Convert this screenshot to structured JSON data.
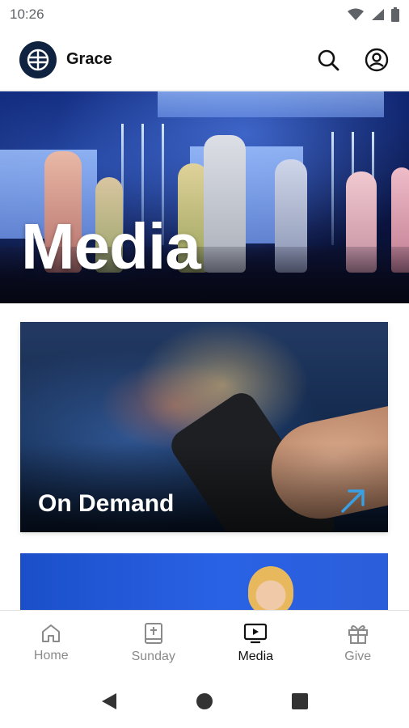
{
  "status_bar": {
    "time": "10:26"
  },
  "header": {
    "brand": "Grace"
  },
  "hero": {
    "title": "Media"
  },
  "cards": [
    {
      "title": "On Demand"
    }
  ],
  "bottom_nav": {
    "items": [
      {
        "label": "Home",
        "icon": "home-icon"
      },
      {
        "label": "Sunday",
        "icon": "bible-icon"
      },
      {
        "label": "Media",
        "icon": "tv-play-icon",
        "active": true
      },
      {
        "label": "Give",
        "icon": "gift-icon"
      }
    ]
  },
  "colors": {
    "brand": "#0f2340",
    "accent": "#3aa0e6",
    "hero_blue": "#0a1f6a",
    "card2_blue": "#2a62e6"
  }
}
